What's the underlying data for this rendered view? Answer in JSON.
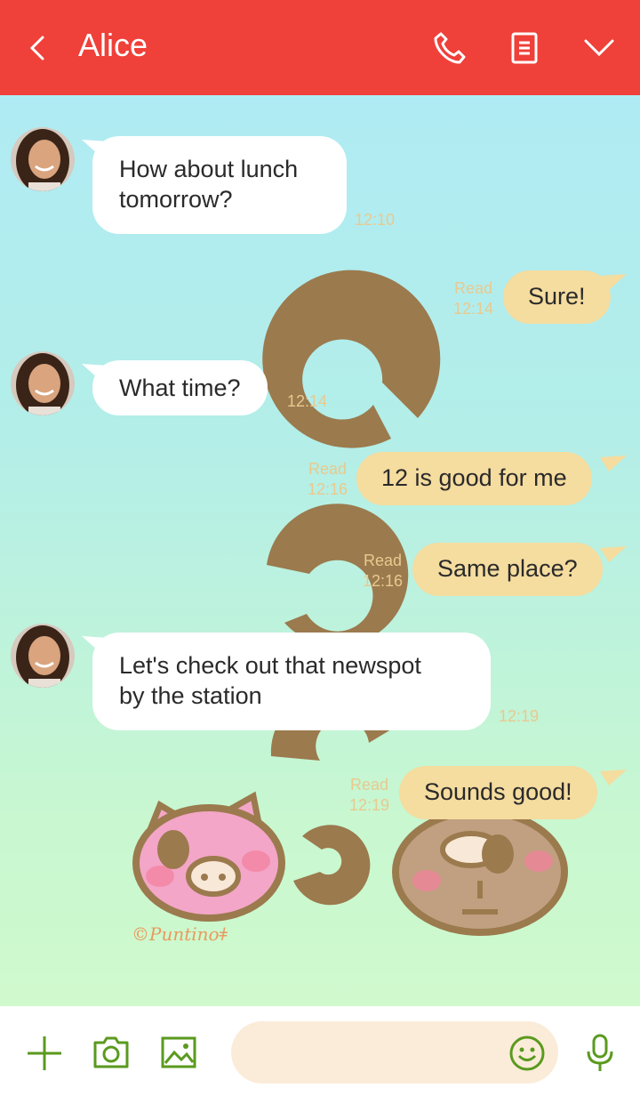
{
  "header": {
    "title": "Alice",
    "back_icon": "chevron-left-icon",
    "call_icon": "phone-icon",
    "notes_icon": "note-icon",
    "more_icon": "chevron-down-icon",
    "background": "#ef4039"
  },
  "messages": [
    {
      "from": "Alice",
      "text": "How about lunch\ntomorrow?",
      "time": "12:10"
    },
    {
      "from": "me",
      "text": "Sure!",
      "read": "Read",
      "time": "12:14"
    },
    {
      "from": "Alice",
      "text": "What time?",
      "time": "12:14"
    },
    {
      "from": "me",
      "text": "12 is good for me",
      "read": "Read",
      "time": "12:16"
    },
    {
      "from": "me",
      "text": "Same place?",
      "read": "Read",
      "time": "12:16"
    },
    {
      "from": "Alice",
      "text": "Let's check out that newspot\nby the station",
      "time": "12:19"
    },
    {
      "from": "me",
      "text": "Sounds good!",
      "read": "Read",
      "time": "12:19"
    }
  ],
  "wallpaper": {
    "signature": "©Puntinoǂ"
  },
  "bottom_bar": {
    "add_icon": "plus-icon",
    "camera_icon": "camera-icon",
    "image_icon": "image-icon",
    "emoji_icon": "smiley-icon",
    "mic_icon": "microphone-icon",
    "accent": "#5a9a1e"
  },
  "colors": {
    "incoming_bubble": "#ffffff",
    "outgoing_bubble": "#f5dc9f",
    "meta_text": "#e9c98f"
  }
}
